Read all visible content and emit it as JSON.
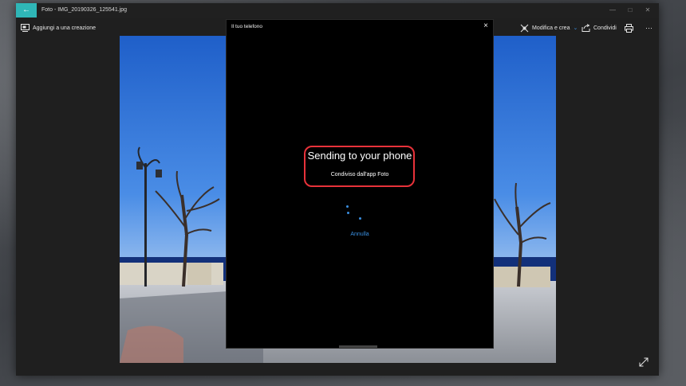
{
  "window": {
    "title": "Foto - IMG_20190326_125541.jpg"
  },
  "toolbar": {
    "add_to_creation": "Aggiungi a una creazione",
    "edit_create": "Modifica e crea",
    "share": "Condividi"
  },
  "dialog": {
    "title": "Il tuo telefono",
    "status_title": "Sending to your phone",
    "status_subtitle": "Condiviso dall'app Foto",
    "cancel_label": "Annulla"
  },
  "colors": {
    "accent": "#2fb6b7",
    "link": "#3a8fe0",
    "highlight": "#e8323a"
  }
}
